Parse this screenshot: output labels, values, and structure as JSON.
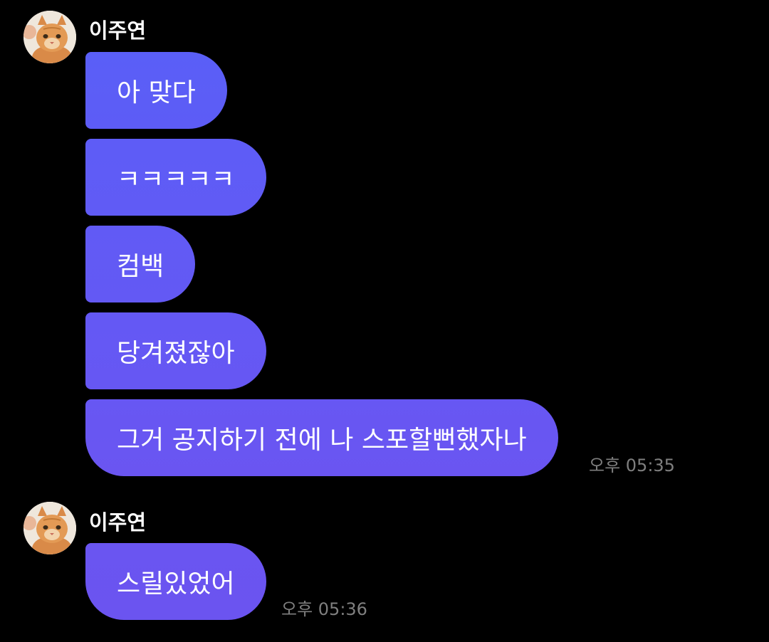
{
  "colors": {
    "background": "#000000",
    "bubble_top": "#5b5ef6",
    "bubble_bottom": "#6a54f0",
    "timestamp": "#7f7f7f"
  },
  "groups": [
    {
      "sender": "이주연",
      "avatar_icon": "orange-cat-avatar-icon",
      "messages": [
        {
          "text": "아 맞다"
        },
        {
          "text": "ㅋㅋㅋㅋㅋ"
        },
        {
          "text": "컴백"
        },
        {
          "text": "당겨졌잖아"
        },
        {
          "text": "그거 공지하기 전에 나 스포할뻔했자나"
        }
      ],
      "time": "오후 05:35"
    },
    {
      "sender": "이주연",
      "avatar_icon": "orange-cat-avatar-icon",
      "messages": [
        {
          "text": "스릴있었어"
        }
      ],
      "time": "오후 05:36"
    }
  ]
}
